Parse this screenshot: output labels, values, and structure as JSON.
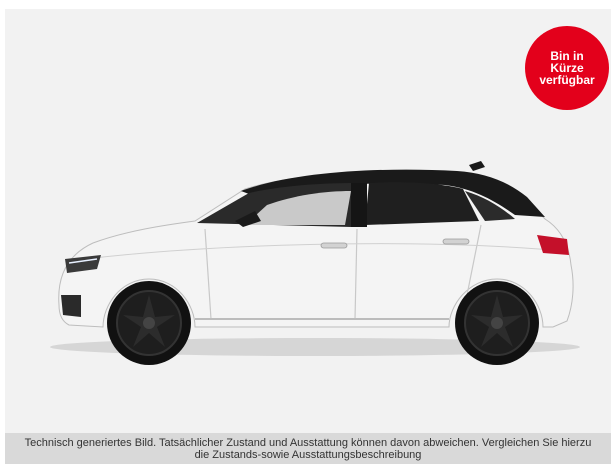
{
  "badge": {
    "line1": "Bin in",
    "line2": "Kürze",
    "line3": "verfügbar",
    "color": "#e3001b"
  },
  "vehicle_image": {
    "icon": "car-side-icon",
    "body_color": "#f4f4f4",
    "roof_color": "#1a1a1a"
  },
  "disclaimer": {
    "line1": "Technisch generiertes Bild. Tatsächlicher Zustand und Ausstattung können davon abweichen. Vergleichen Sie hierzu",
    "line2": "die Zustands-sowie Ausstattungsbeschreibung"
  }
}
